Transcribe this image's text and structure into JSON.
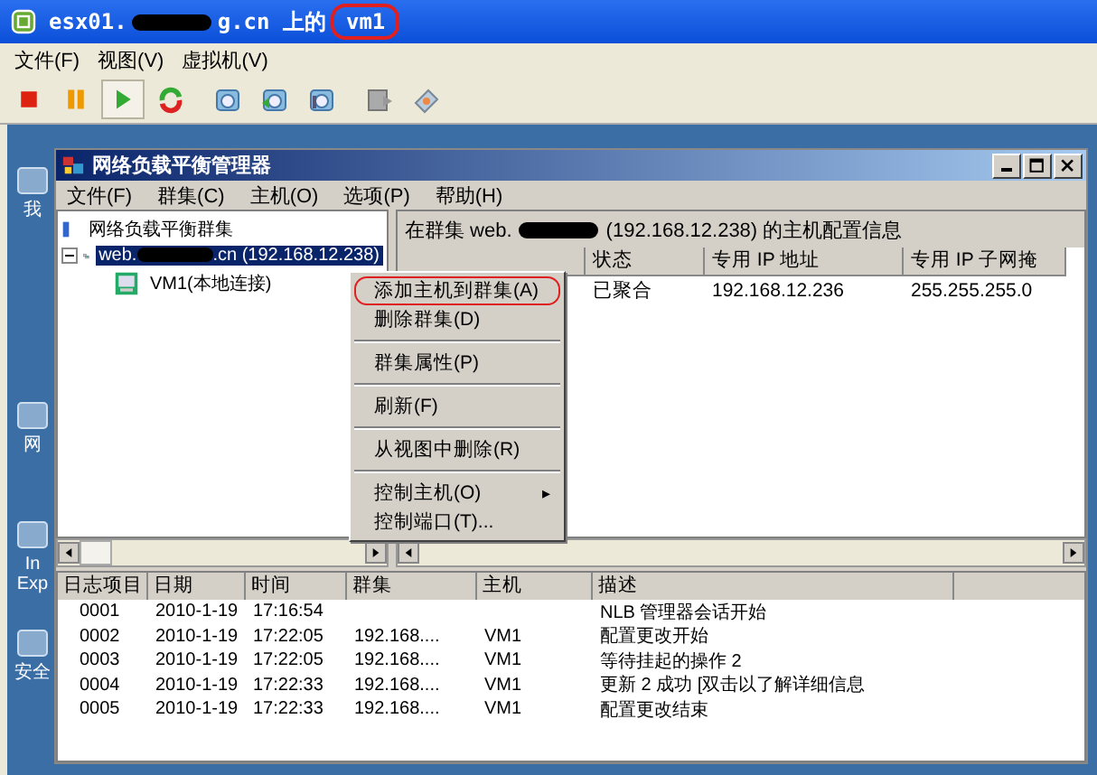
{
  "window": {
    "title_prefix": "esx01.",
    "title_suffix": "g.cn 上的",
    "vm_name": "vm1",
    "vm_name_circled": true
  },
  "menu": [
    "文件(F)",
    "视图(V)",
    "虚拟机(V)"
  ],
  "toolbar": [
    {
      "kind": "stop",
      "pressed": false
    },
    {
      "kind": "pause",
      "pressed": false
    },
    {
      "kind": "play",
      "pressed": true
    },
    {
      "kind": "reset",
      "pressed": false
    },
    {
      "kind": "snapshot",
      "pressed": false
    },
    {
      "kind": "revert",
      "pressed": false
    },
    {
      "kind": "manage",
      "pressed": false
    },
    {
      "kind": "disk",
      "pressed": false
    },
    {
      "kind": "tools",
      "pressed": false
    }
  ],
  "desktop_icons": [
    {
      "label": "我"
    },
    {
      "label": "网"
    },
    {
      "label": "In Exp"
    },
    {
      "label": "安全"
    }
  ],
  "nlb": {
    "title": "网络负载平衡管理器",
    "menu": [
      "文件(F)",
      "群集(C)",
      "主机(O)",
      "选项(P)",
      "帮助(H)"
    ],
    "tree": [
      {
        "label": "网络负载平衡群集",
        "selected": false,
        "children": [
          {
            "label_prefix": "web.",
            "label_suffix": ".cn (192.168.12.238)",
            "expanded": true,
            "selected": true,
            "children": [
              {
                "label": "VM1(本地连接)",
                "selected": false
              }
            ]
          }
        ]
      }
    ],
    "details": {
      "heading_prefix": "在群集 web.",
      "heading_suffix": "(192.168.12.238) 的主机配置信息",
      "columns": [
        "状态",
        "专用 IP 地址",
        "专用 IP 子网掩"
      ],
      "rows": [
        [
          "已聚合",
          "192.168.12.236",
          "255.255.255.0"
        ]
      ]
    },
    "context_menu": [
      {
        "kind": "item",
        "label": "添加主机到群集(A)",
        "circled": true
      },
      {
        "kind": "item",
        "label": "删除群集(D)",
        "circled": false
      },
      {
        "kind": "separator"
      },
      {
        "kind": "item",
        "label": "群集属性(P)",
        "circled": false
      },
      {
        "kind": "separator"
      },
      {
        "kind": "item",
        "label": "刷新(F)",
        "circled": false
      },
      {
        "kind": "separator"
      },
      {
        "kind": "item",
        "label": "从视图中删除(R)",
        "circled": false
      },
      {
        "kind": "separator"
      },
      {
        "kind": "submenu",
        "label": "控制主机(O)",
        "arrow": "▸",
        "circled": false
      },
      {
        "kind": "item",
        "label": "控制端口(T)...",
        "circled": false
      }
    ],
    "log": {
      "columns": [
        "日志项目",
        "日期",
        "时间",
        "群集",
        "主机",
        "描述"
      ],
      "rows": [
        [
          "0001",
          "2010-1-19",
          "17:16:54",
          "",
          "",
          "NLB 管理器会话开始"
        ],
        [
          "0002",
          "2010-1-19",
          "17:22:05",
          "192.168....",
          "VM1",
          "配置更改开始"
        ],
        [
          "0003",
          "2010-1-19",
          "17:22:05",
          "192.168....",
          "VM1",
          "等待挂起的操作 2"
        ],
        [
          "0004",
          "2010-1-19",
          "17:22:33",
          "192.168....",
          "VM1",
          "更新 2 成功 [双击以了解详细信息"
        ],
        [
          "0005",
          "2010-1-19",
          "17:22:33",
          "192.168....",
          "VM1",
          "配置更改结束"
        ]
      ]
    }
  }
}
